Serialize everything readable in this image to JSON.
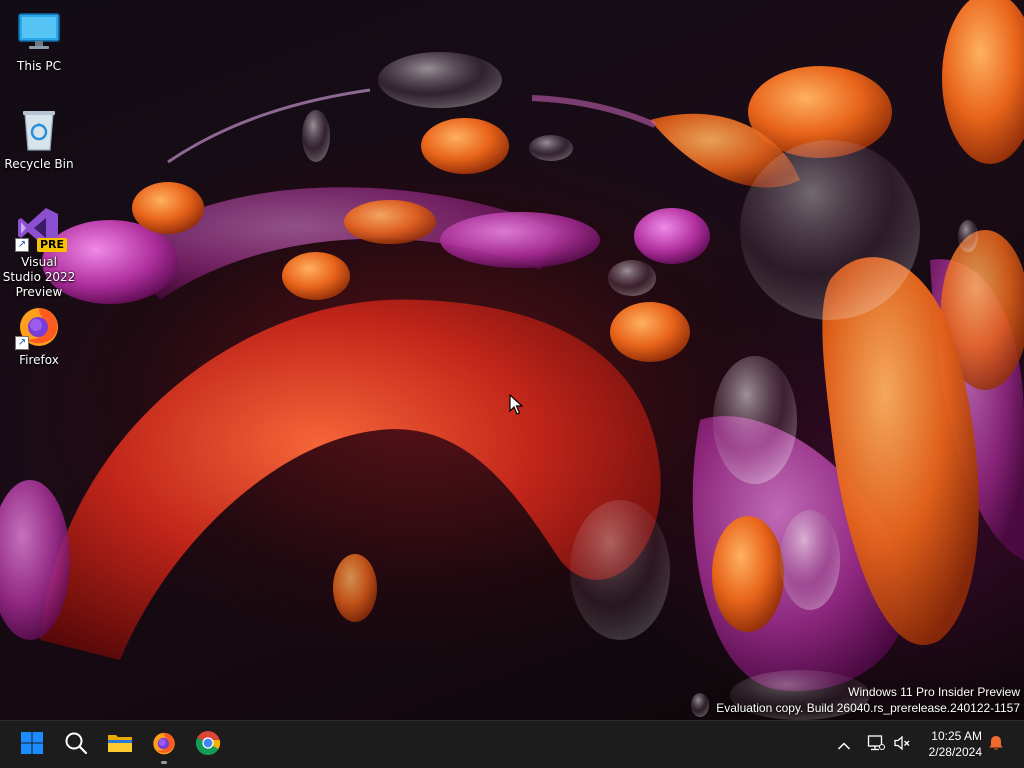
{
  "desktop": {
    "icons": [
      {
        "label": "This PC",
        "icon": "monitor-icon"
      },
      {
        "label": "Recycle Bin",
        "icon": "recycle-bin-icon"
      },
      {
        "label": "Visual Studio 2022 Preview",
        "icon": "visual-studio-icon",
        "badge": "PRE"
      },
      {
        "label": "Firefox",
        "icon": "firefox-icon"
      }
    ]
  },
  "watermark": {
    "line1": "Windows 11 Pro Insider Preview",
    "line2": "Evaluation copy. Build 26040.rs_prerelease.240122-1157"
  },
  "taskbar": {
    "pinned": [
      {
        "name": "Start",
        "icon": "windows-start-icon"
      },
      {
        "name": "Search",
        "icon": "search-icon"
      },
      {
        "name": "File Explorer",
        "icon": "folder-icon"
      },
      {
        "name": "Firefox",
        "icon": "firefox-icon",
        "running": true
      },
      {
        "name": "Google Chrome",
        "icon": "chrome-icon"
      }
    ],
    "tray": {
      "icons": [
        "chevron-up-icon",
        "network-icon",
        "volume-muted-icon"
      ],
      "time": "10:25 AM",
      "date": "2/28/2024",
      "notification_icon": "bell-icon"
    }
  },
  "colors": {
    "taskbar_bg": "#1c1c1c",
    "start_blue": "#1a8cff",
    "notification_orange": "#f06a30"
  }
}
